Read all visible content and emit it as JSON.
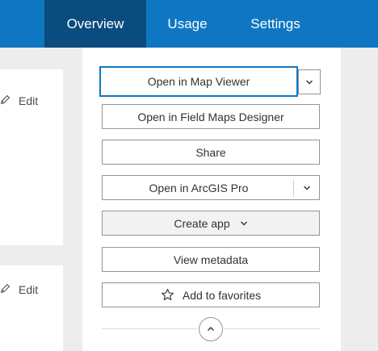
{
  "tabs": [
    {
      "label": "Overview",
      "active": true
    },
    {
      "label": "Usage",
      "active": false
    },
    {
      "label": "Settings",
      "active": false
    }
  ],
  "cards": [
    {
      "edit_label": "Edit"
    },
    {
      "edit_label": "Edit"
    }
  ],
  "actions": {
    "open_map_viewer": "Open in Map Viewer",
    "open_field_maps": "Open in Field Maps Designer",
    "share": "Share",
    "open_arcgis_pro": "Open in ArcGIS Pro",
    "create_app": "Create app",
    "view_metadata": "View metadata",
    "add_favorites": "Add to favorites"
  },
  "icons": {
    "edit": "pencil-icon",
    "dropdown": "chevron-down-icon",
    "favorites": "star-icon",
    "collapse": "chevron-up-icon"
  },
  "colors": {
    "brand": "#0f77c2",
    "active_tab": "#0a4c7e",
    "background": "#ededed"
  }
}
